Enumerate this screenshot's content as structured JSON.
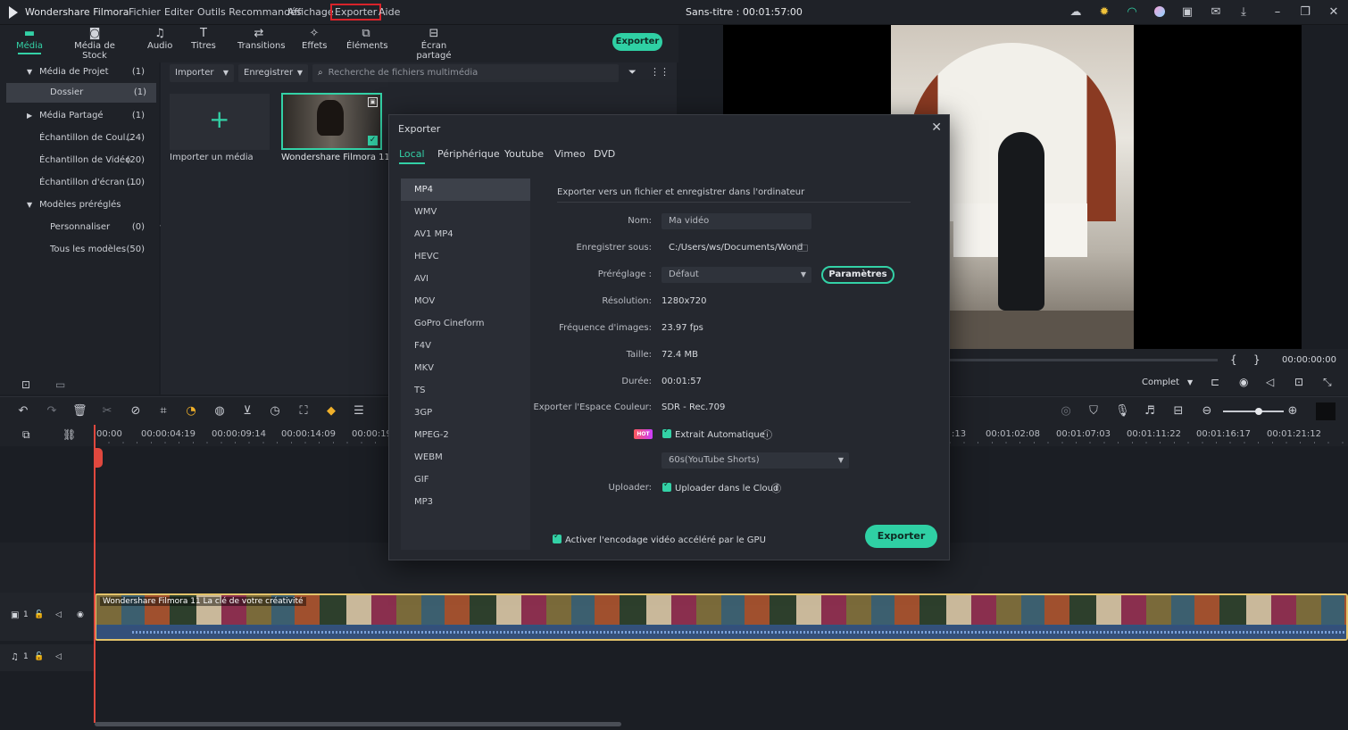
{
  "app": {
    "name": "Wondershare Filmora",
    "document_title": "Sans-titre : 00:01:57:00"
  },
  "menu": {
    "items": [
      "Fichier",
      "Editer",
      "Outils Recommandés",
      "Affichage",
      "Exporter",
      "Aide"
    ],
    "highlighted": "Exporter"
  },
  "toolbar": {
    "tools": [
      {
        "label": "Média",
        "icon": "folder-icon"
      },
      {
        "label": "Média de Stock",
        "icon": "stock-media-icon"
      },
      {
        "label": "Audio",
        "icon": "music-note-icon"
      },
      {
        "label": "Titres",
        "icon": "text-icon"
      },
      {
        "label": "Transitions",
        "icon": "transitions-icon"
      },
      {
        "label": "Effets",
        "icon": "effects-icon"
      },
      {
        "label": "Éléments",
        "icon": "elements-icon"
      },
      {
        "label": "Écran partagé",
        "icon": "split-screen-icon"
      }
    ],
    "export_label": "Exporter"
  },
  "leftpanel": {
    "items": [
      {
        "label": "Média de Projet",
        "count": "(1)",
        "arrow": "▼"
      },
      {
        "label": "Dossier",
        "count": "(1)",
        "arrow": ""
      },
      {
        "label": "Média Partagé",
        "count": "(1)",
        "arrow": "▶"
      },
      {
        "label": "Échantillon de Coul...",
        "count": "(24)",
        "arrow": ""
      },
      {
        "label": "Échantillon de Vidéo",
        "count": "(20)",
        "arrow": ""
      },
      {
        "label": "Échantillon d'écran ...",
        "count": "(10)",
        "arrow": ""
      },
      {
        "label": "Modèles préréglés",
        "count": "",
        "arrow": "▼"
      },
      {
        "label": "Personnaliser",
        "count": "(0)",
        "arrow": ""
      },
      {
        "label": "Tous les modèles",
        "count": "(50)",
        "arrow": ""
      }
    ]
  },
  "media": {
    "import_label": "Importer",
    "save_label": "Enregistrer",
    "search_placeholder": "Recherche de fichiers multimédia",
    "import_media_label": "Importer un média",
    "clip_label": "Wondershare Filmora 11..."
  },
  "preview": {
    "timecode": "00:00:00:00",
    "quality": "Complet",
    "mark_in": "{",
    "mark_out": "}"
  },
  "timeline": {
    "ruler_left": [
      "00:00",
      "00:00:04:19",
      "00:00:09:14",
      "00:00:14:09",
      "00:00:19"
    ],
    "ruler_right": [
      ":13",
      "00:01:02:08",
      "00:01:07:03",
      "00:01:11:22",
      "00:01:16:17",
      "00:01:21:12"
    ],
    "clip_title": "Wondershare Filmora 11  La clé de votre créativité",
    "track_video_label": "1",
    "track_audio_label": "1"
  },
  "export_dialog": {
    "title": "Exporter",
    "tabs": [
      "Local",
      "Périphérique",
      "Youtube",
      "Vimeo",
      "DVD"
    ],
    "active_tab": "Local",
    "formats": [
      "MP4",
      "WMV",
      "AV1 MP4",
      "HEVC",
      "AVI",
      "MOV",
      "GoPro Cineform",
      "F4V",
      "MKV",
      "TS",
      "3GP",
      "MPEG-2",
      "WEBM",
      "GIF",
      "MP3"
    ],
    "active_format": "MP4",
    "heading": "Exporter vers un fichier et enregistrer dans l'ordinateur",
    "fields": {
      "name_label": "Nom:",
      "name_value": "Ma vidéo",
      "save_label": "Enregistrer sous:",
      "save_value": "C:/Users/ws/Documents/Wond",
      "preset_label": "Préréglage :",
      "preset_value": "Défaut",
      "params_button": "Paramètres",
      "resolution_label": "Résolution:",
      "resolution_value": "1280x720",
      "fps_label": "Fréquence d'images:",
      "fps_value": "23.97 fps",
      "size_label": "Taille:",
      "size_value": "72.4 MB",
      "duration_label": "Durée:",
      "duration_value": "00:01:57",
      "colorspace_label": "Exporter l'Espace Couleur:",
      "colorspace_value": "SDR - Rec.709",
      "hot_badge": "HOT",
      "auto_extract_label": "Extrait Automatique",
      "shorts_value": "60s(YouTube Shorts)",
      "uploader_label": "Uploader:",
      "cloud_label": "Uploader dans le Cloud",
      "gpu_label": "Activer l'encodage vidéo accéléré par le GPU"
    },
    "export_button": "Exporter"
  },
  "colors": {
    "accent": "#33d1a6",
    "highlight_red": "#d8232a",
    "playhead": "#e0483e",
    "clip_border": "#e2c36a"
  }
}
